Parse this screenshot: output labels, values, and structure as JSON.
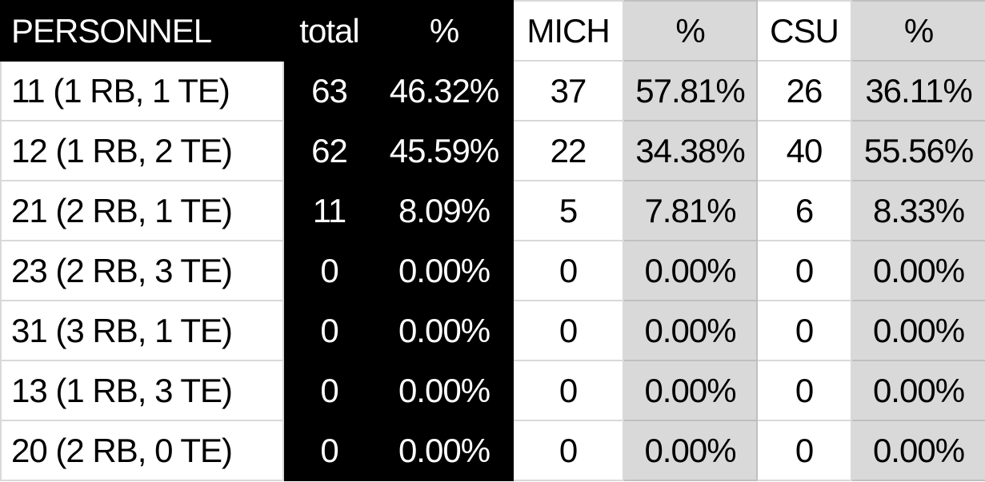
{
  "headers": [
    "PERSONNEL",
    "total",
    "%",
    "MICH",
    "%",
    "CSU",
    "%"
  ],
  "rows": [
    [
      "11 (1 RB, 1 TE)",
      "63",
      "46.32%",
      "37",
      "57.81%",
      "26",
      "36.11%"
    ],
    [
      "12 (1 RB, 2 TE)",
      "62",
      "45.59%",
      "22",
      "34.38%",
      "40",
      "55.56%"
    ],
    [
      "21 (2 RB, 1 TE)",
      "11",
      "8.09%",
      "5",
      "7.81%",
      "6",
      "8.33%"
    ],
    [
      "23 (2 RB, 3 TE)",
      "0",
      "0.00%",
      "0",
      "0.00%",
      "0",
      "0.00%"
    ],
    [
      "31 (3 RB, 1 TE)",
      "0",
      "0.00%",
      "0",
      "0.00%",
      "0",
      "0.00%"
    ],
    [
      "13 (1 RB, 3 TE)",
      "0",
      "0.00%",
      "0",
      "0.00%",
      "0",
      "0.00%"
    ],
    [
      "20 (2 RB, 0 TE)",
      "0",
      "0.00%",
      "0",
      "0.00%",
      "0",
      "0.00%"
    ]
  ],
  "colors": {
    "dark": "#000000",
    "light": "#ffffff",
    "gray": "#d9d9d9"
  }
}
